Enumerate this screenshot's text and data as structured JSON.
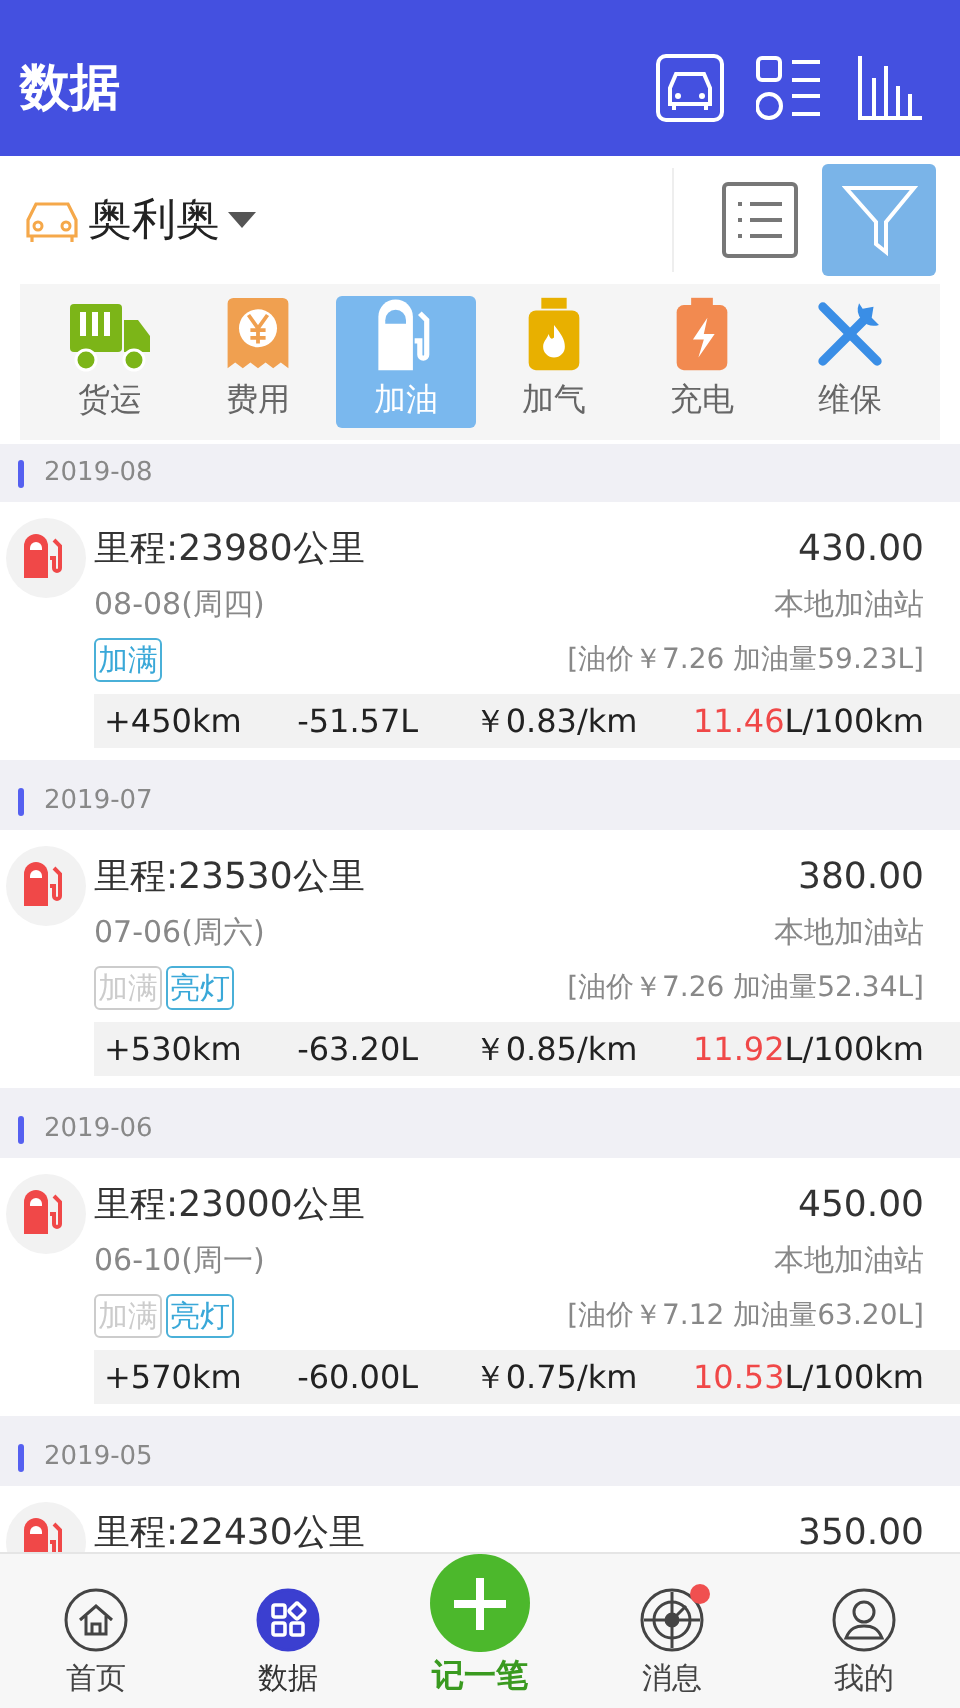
{
  "header": {
    "title": "数据"
  },
  "vehicle": {
    "name": "奥利奥"
  },
  "filter": {
    "on": true
  },
  "categories": [
    {
      "kind": "freight",
      "label": "货运",
      "selected": false
    },
    {
      "kind": "expense",
      "label": "费用",
      "selected": false
    },
    {
      "kind": "fuel",
      "label": "加油",
      "selected": true
    },
    {
      "kind": "gas",
      "label": "加气",
      "selected": false
    },
    {
      "kind": "charge",
      "label": "充电",
      "selected": false
    },
    {
      "kind": "maintenance",
      "label": "维保",
      "selected": false
    }
  ],
  "groups": [
    {
      "month": "2019-08",
      "records": [
        {
          "mileage": "里程:23980公里",
          "amount": "430.00",
          "date": "08-08(周四)",
          "station": "本地加油站",
          "tags": [
            {
              "label": "加满",
              "on": true
            }
          ],
          "price_info": "[油价￥7.26  加油量59.23L]",
          "stats": {
            "distance": "+450km",
            "fuel": "-51.57L",
            "cost": "￥0.83/km",
            "consumption": "11.46",
            "consumption_unit": "L/100km"
          }
        }
      ]
    },
    {
      "month": "2019-07",
      "records": [
        {
          "mileage": "里程:23530公里",
          "amount": "380.00",
          "date": "07-06(周六)",
          "station": "本地加油站",
          "tags": [
            {
              "label": "加满",
              "on": false
            },
            {
              "label": "亮灯",
              "on": true
            }
          ],
          "price_info": "[油价￥7.26  加油量52.34L]",
          "stats": {
            "distance": "+530km",
            "fuel": "-63.20L",
            "cost": "￥0.85/km",
            "consumption": "11.92",
            "consumption_unit": "L/100km"
          }
        }
      ]
    },
    {
      "month": "2019-06",
      "records": [
        {
          "mileage": "里程:23000公里",
          "amount": "450.00",
          "date": "06-10(周一)",
          "station": "本地加油站",
          "tags": [
            {
              "label": "加满",
              "on": false
            },
            {
              "label": "亮灯",
              "on": true
            }
          ],
          "price_info": "[油价￥7.12  加油量63.20L]",
          "stats": {
            "distance": "+570km",
            "fuel": "-60.00L",
            "cost": "￥0.75/km",
            "consumption": "10.53",
            "consumption_unit": "L/100km"
          }
        }
      ]
    },
    {
      "month": "2019-05",
      "records": [
        {
          "mileage": "里程:22430公里",
          "amount": "350.00"
        }
      ]
    }
  ],
  "nav": [
    {
      "kind": "home",
      "label": "首页",
      "selected": false,
      "badge": false
    },
    {
      "kind": "data",
      "label": "数据",
      "selected": true,
      "badge": false
    },
    {
      "kind": "add",
      "label": "记一笔"
    },
    {
      "kind": "messages",
      "label": "消息",
      "selected": false,
      "badge": true
    },
    {
      "kind": "profile",
      "label": "我的",
      "selected": false,
      "badge": false
    }
  ]
}
